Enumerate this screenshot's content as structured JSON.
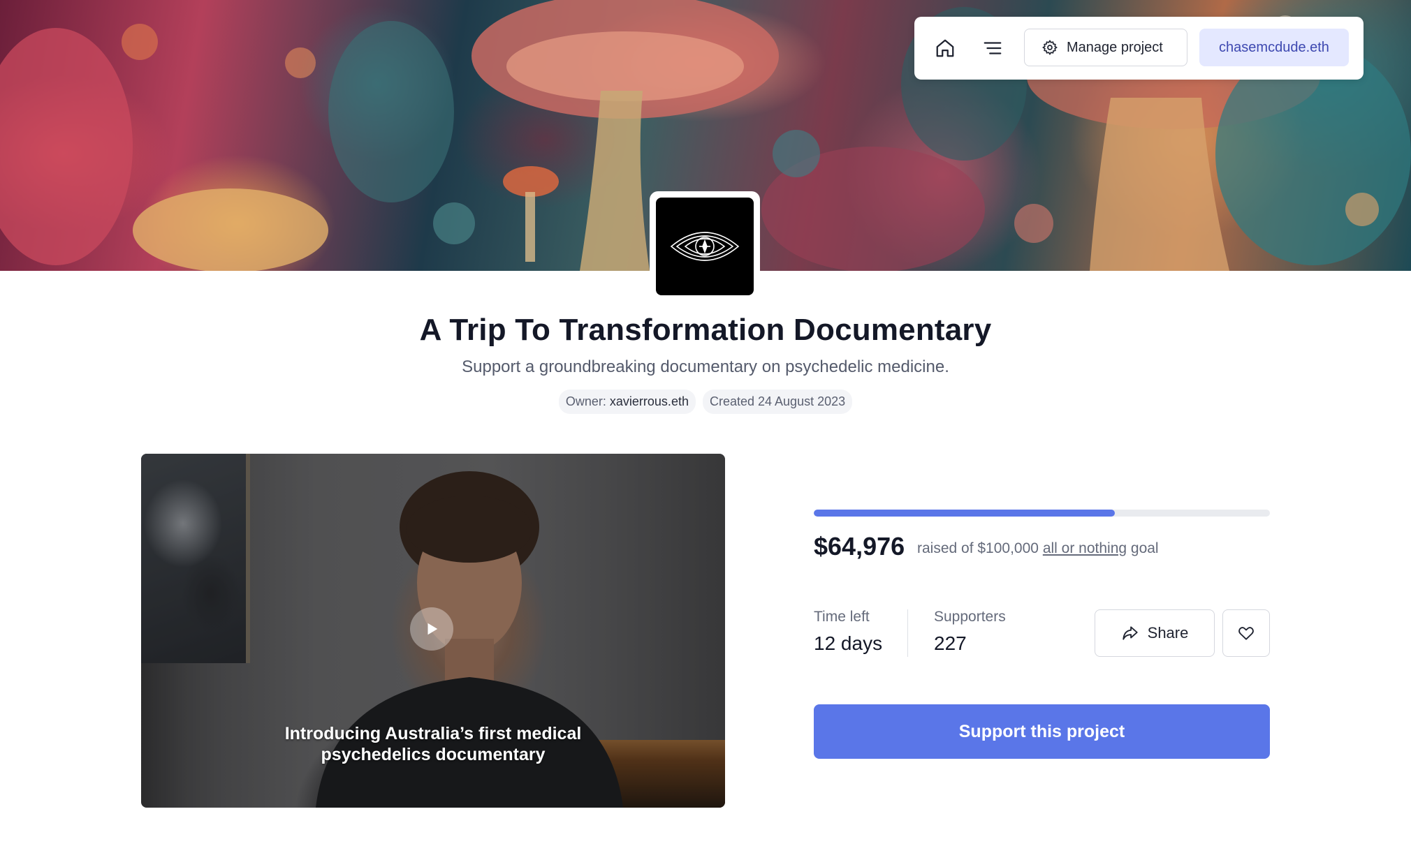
{
  "nav": {
    "home_icon": "home-icon",
    "menu_icon": "menu-icon",
    "manage_label": "Manage project",
    "manage_icon": "gear-icon",
    "user_label": "chasemcdude.eth"
  },
  "project": {
    "logo_icon": "eye-icon",
    "title": "A Trip To Transformation Documentary",
    "subtitle": "Support a groundbreaking documentary on psychedelic medicine.",
    "owner_prefix": "Owner: ",
    "owner": "xavierrous.eth",
    "created": "Created 24 August 2023"
  },
  "video": {
    "play_icon": "play-icon",
    "caption_line1": "Introducing Australia’s first medical",
    "caption_line2": "psychedelics documentary"
  },
  "funding": {
    "progress_fraction": 0.66,
    "raised": "$64,976",
    "goal_prefix": "raised of $100,000 ",
    "goal_link": "all or nothing",
    "goal_suffix": " goal",
    "time_left_label": "Time left",
    "time_left_value": "12 days",
    "supporters_label": "Supporters",
    "supporters_value": "227",
    "share_label": "Share",
    "share_icon": "share-icon",
    "favorite_icon": "heart-icon",
    "support_label": "Support this project"
  },
  "colors": {
    "accent": "#5a76e8",
    "user_badge_bg": "#e4e8ff",
    "user_badge_text": "#3d48b0"
  }
}
